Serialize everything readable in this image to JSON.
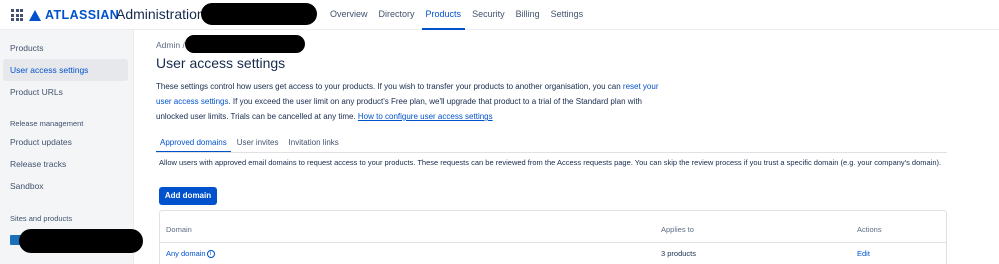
{
  "header": {
    "brand": "ATLASSIAN",
    "title": "Administration",
    "nav": [
      "Overview",
      "Directory",
      "Products",
      "Security",
      "Billing",
      "Settings"
    ],
    "active_nav": "Products"
  },
  "sidebar": {
    "items": [
      "Products",
      "User access settings",
      "Product URLs"
    ],
    "release_heading": "Release management",
    "release_items": [
      "Product updates",
      "Release tracks",
      "Sandbox"
    ],
    "sites_heading": "Sites and products"
  },
  "main": {
    "breadcrumb": "Admin  /",
    "title": "User access settings",
    "desc_part1": "These settings control how users get access to your products. If you wish to transfer your products to another organisation, you can",
    "desc_link1": "reset your user access settings",
    "desc_part2": ". If you exceed the user limit on any product's Free plan, we'll upgrade that product to a trial of the Standard plan with unlocked user limits. Trials can be cancelled at any time.",
    "desc_link2": "How to configure user access settings",
    "tabs": [
      "Approved domains",
      "User invites",
      "Invitation links"
    ],
    "info": "Allow users with approved email domains to request access to your products. These requests can be reviewed from the Access requests page. You can skip the review process if you trust a specific domain (e.g. your company's domain).",
    "add_button": "Add domain",
    "table": {
      "headers": [
        "Domain",
        "Applies to",
        "Actions"
      ],
      "rows": [
        {
          "domain": "Any domain",
          "applies": "3 products",
          "action": "Edit"
        }
      ]
    }
  },
  "colors": {
    "accent": "#0052cc",
    "text": "#172b4d",
    "sidebar_bg": "#f4f5f7"
  }
}
